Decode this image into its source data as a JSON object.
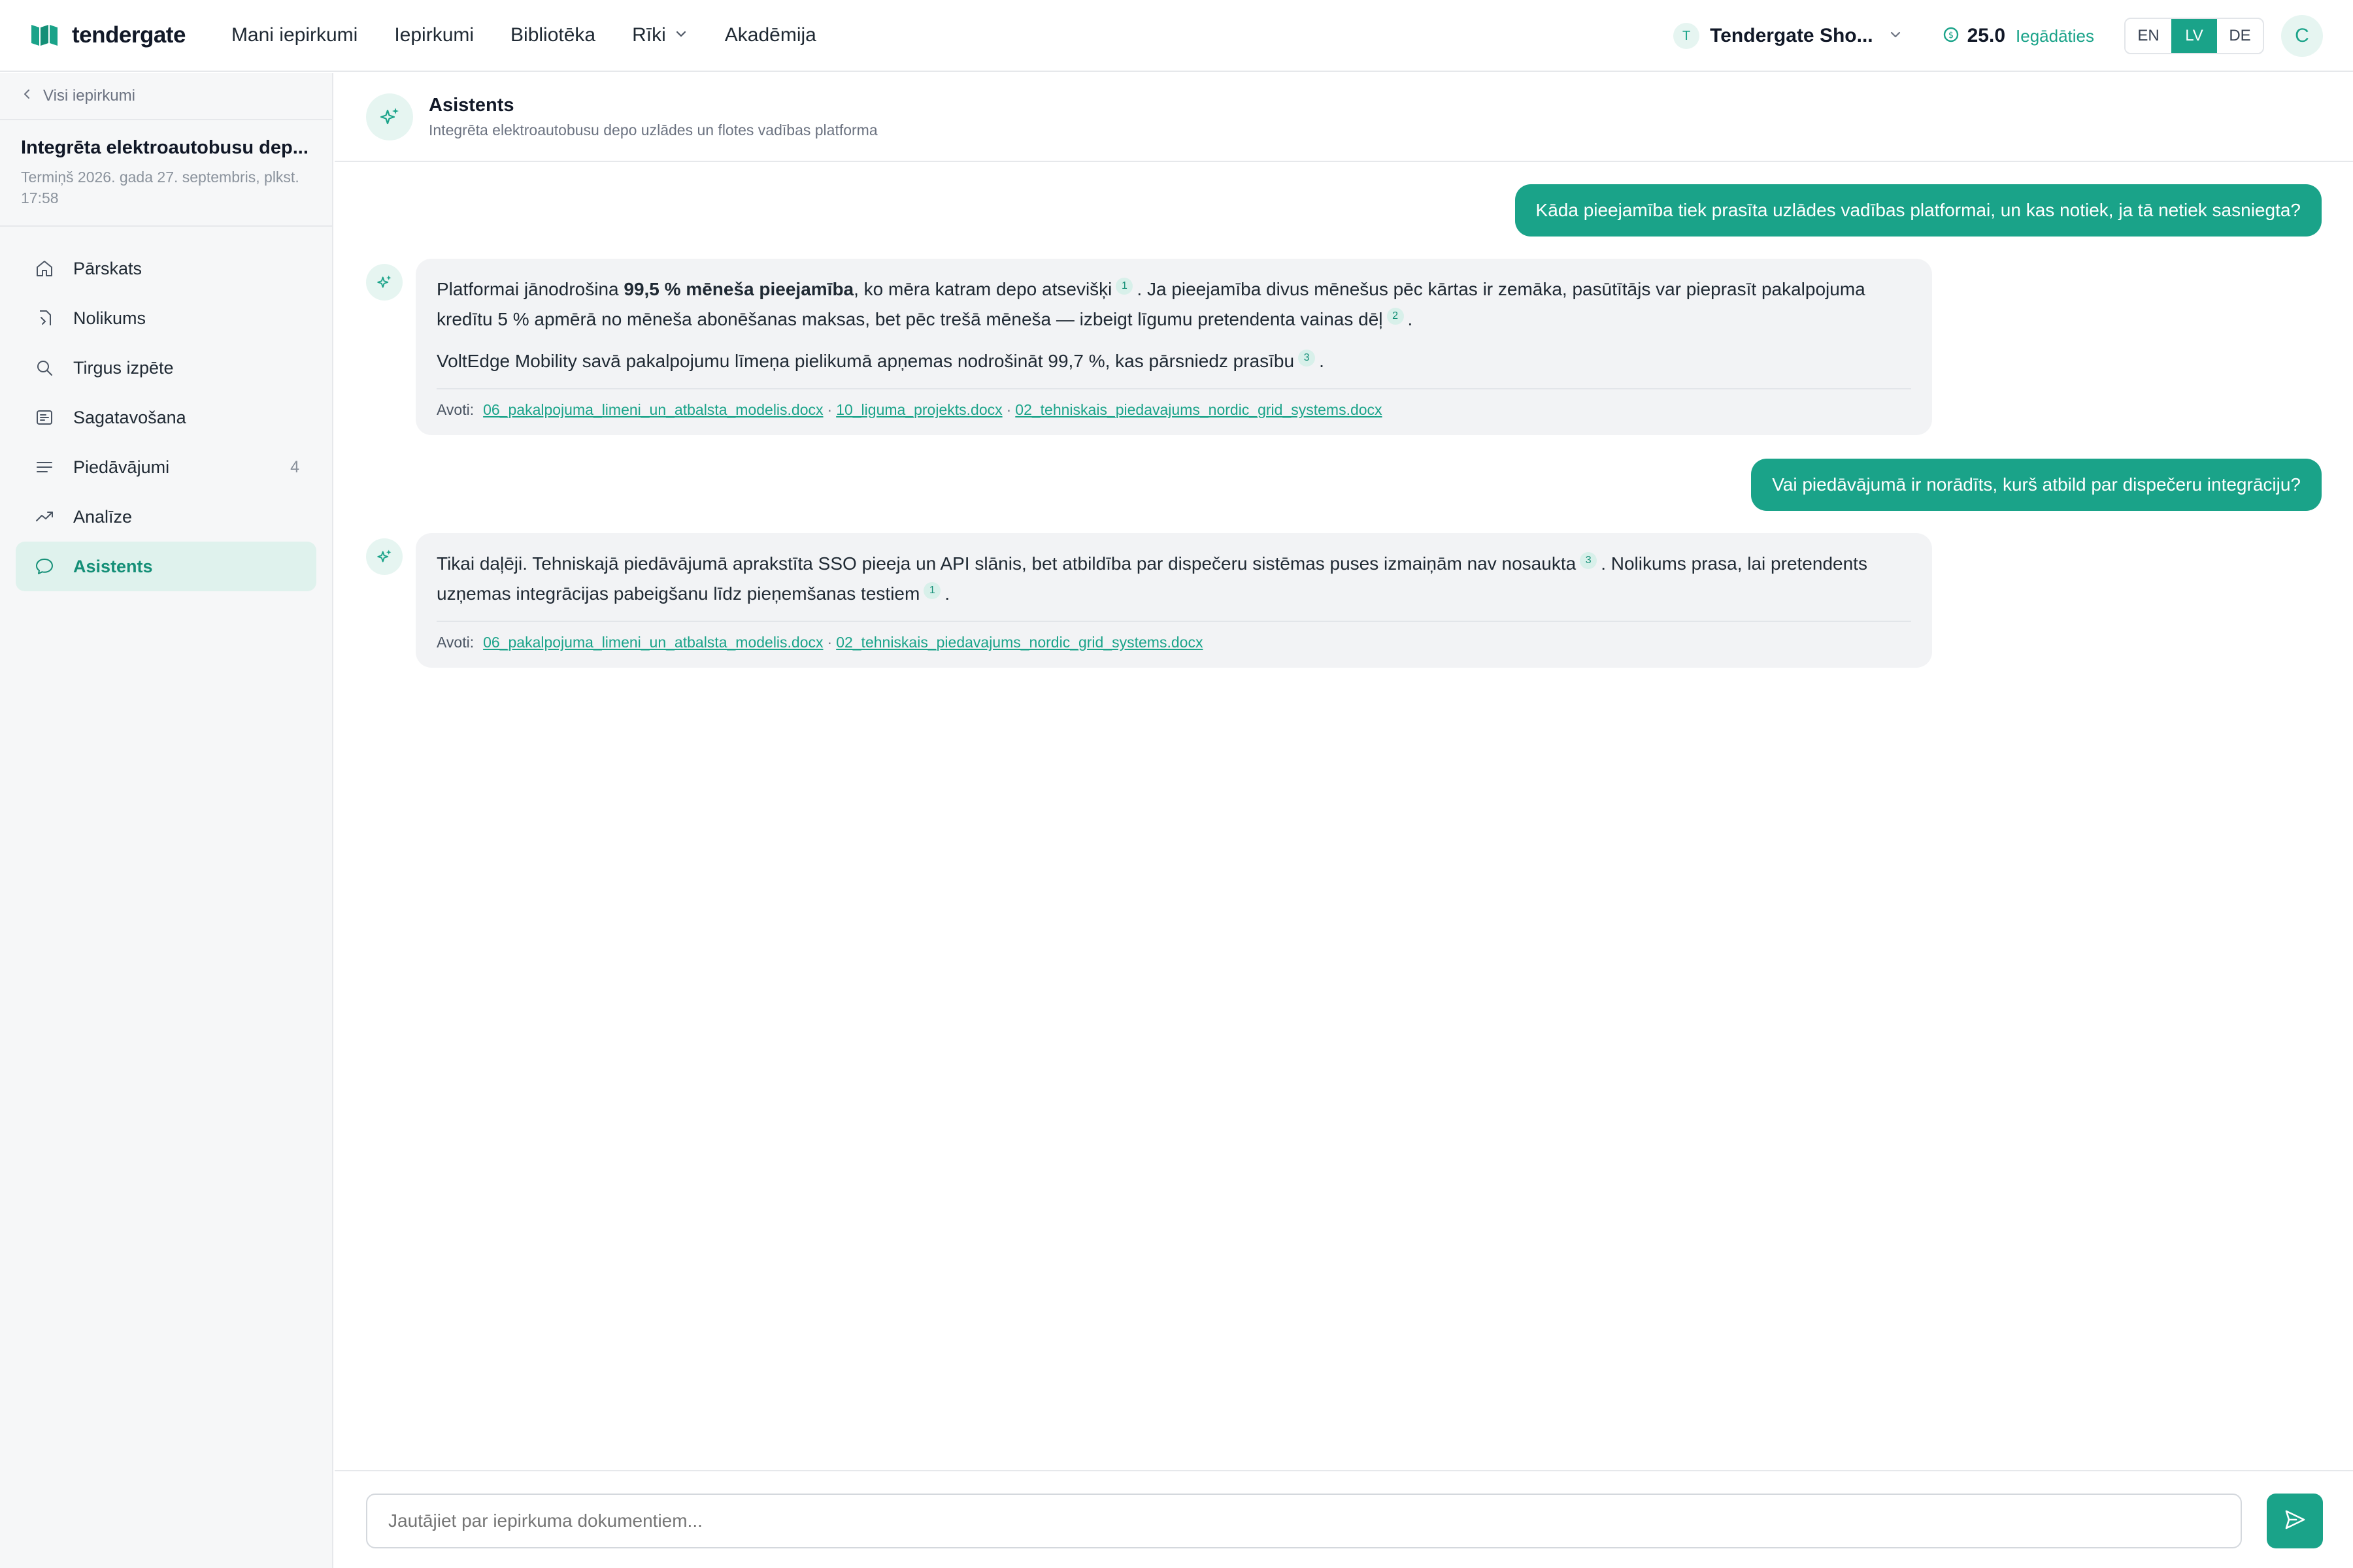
{
  "brand": {
    "name": "tendergate",
    "accent": "#1aa389"
  },
  "nav": {
    "items": [
      {
        "label": "Mani iepirkumi"
      },
      {
        "label": "Iepirkumi"
      },
      {
        "label": "Bibliotēka"
      },
      {
        "label": "Rīki",
        "has_dropdown": true
      },
      {
        "label": "Akadēmija"
      }
    ]
  },
  "org": {
    "badge": "T",
    "name": "Tendergate Sho..."
  },
  "credits": {
    "value": "25.0",
    "link": "Iegādāties"
  },
  "languages": {
    "options": [
      "EN",
      "LV",
      "DE"
    ],
    "active": "LV"
  },
  "user": {
    "initial": "C"
  },
  "sidebar": {
    "back_label": "Visi iepirkumi",
    "tender_title": "Integrēta elektroautobusu dep...",
    "tender_deadline": "Termiņš 2026. gada 27. septembris, plkst. 17:58",
    "items": [
      {
        "label": "Pārskats",
        "icon": "home-icon"
      },
      {
        "label": "Nolikums",
        "icon": "document-icon"
      },
      {
        "label": "Tirgus izpēte",
        "icon": "search-icon"
      },
      {
        "label": "Sagatavošana",
        "icon": "draft-icon"
      },
      {
        "label": "Piedāvājumi",
        "icon": "list-icon",
        "count": "4"
      },
      {
        "label": "Analīze",
        "icon": "trend-icon"
      },
      {
        "label": "Asistents",
        "icon": "chat-icon",
        "active": true
      }
    ]
  },
  "chat": {
    "title": "Asistents",
    "subtitle": "Integrēta elektroautobusu depo uzlādes un flotes vadības platforma",
    "messages": [
      {
        "role": "user",
        "text": "Kāda pieejamība tiek prasīta uzlādes vadības platformai, un kas notiek, ja tā netiek sasniegta?"
      },
      {
        "role": "assistant",
        "p1_a": "Platformai jānodrošina ",
        "p1_bold": "99,5 % mēneša pieejamība",
        "p1_b": ", ko mēra katram depo atsevišķi",
        "p1_cite1": "1",
        "p1_c": ". Ja pieejamība divus mēnešus pēc kārtas ir zemāka, pasūtītājs var pieprasīt pakalpojuma kredītu 5 % apmērā no mēneša abonēšanas maksas, bet pēc trešā mēneša — izbeigt līgumu pretendenta vainas dēļ",
        "p1_cite2": "2",
        "p1_d": ".",
        "p2_a": "VoltEdge Mobility savā pakalpojumu līmeņa pielikumā apņemas nodrošināt 99,7 %, kas pārsniedz prasību",
        "p2_cite": "3",
        "p2_b": ".",
        "sources_label": "Avoti:",
        "sources": [
          "06_pakalpojuma_limeni_un_atbalsta_modelis.docx",
          "10_liguma_projekts.docx",
          "02_tehniskais_piedavajums_nordic_grid_systems.docx"
        ],
        "sep": "·"
      },
      {
        "role": "user",
        "text": "Vai piedāvājumā ir norādīts, kurš atbild par dispečeru integrāciju?"
      },
      {
        "role": "assistant",
        "p1_a": "Tikai daļēji. Tehniskajā piedāvājumā aprakstīta SSO pieeja un API slānis, bet atbildība par dispečeru sistēmas puses izmaiņām nav nosaukta",
        "p1_cite1": "3",
        "p1_b": ". Nolikums prasa, lai pretendents uzņemas integrācijas pabeigšanu līdz pieņemšanas testiem",
        "p1_cite2": "1",
        "p1_c": ".",
        "sources_label": "Avoti:",
        "sources": [
          "06_pakalpojuma_limeni_un_atbalsta_modelis.docx",
          "02_tehniskais_piedavajums_nordic_grid_systems.docx"
        ],
        "sep": "·"
      }
    ]
  },
  "composer": {
    "placeholder": "Jautājiet par iepirkuma dokumentiem..."
  }
}
